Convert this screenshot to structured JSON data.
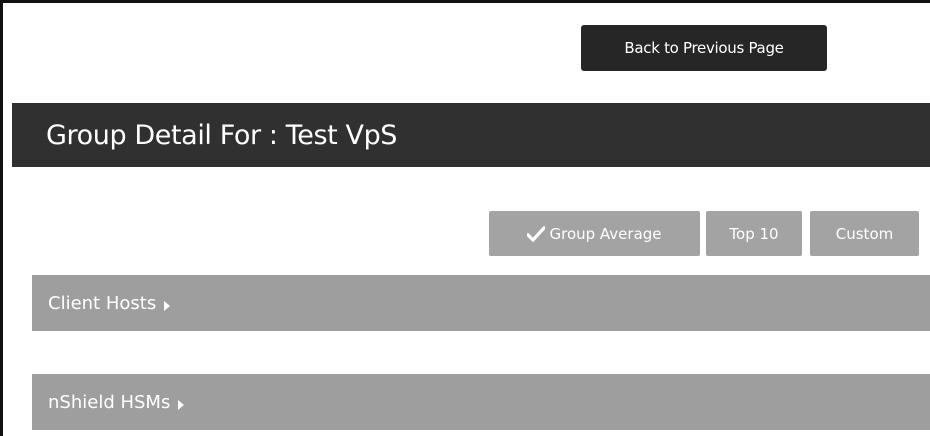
{
  "header": {
    "back_label": "Back to Previous Page",
    "title": "Group Detail For : Test VpS"
  },
  "view_options": [
    {
      "label": "Group Average",
      "icon": "check-icon",
      "selected": true
    },
    {
      "label": "Top 10",
      "selected": false
    },
    {
      "label": "Custom",
      "selected": false
    }
  ],
  "sections": [
    {
      "label": "Client Hosts",
      "icon": "caret-right-icon",
      "expanded": false
    },
    {
      "label": "nShield HSMs",
      "icon": "caret-right-icon",
      "expanded": false
    }
  ],
  "colors": {
    "dark_bar": "#303030",
    "button_dark": "#262626",
    "button_gray": "#a3a3a3",
    "section_gray": "#9e9e9e"
  }
}
